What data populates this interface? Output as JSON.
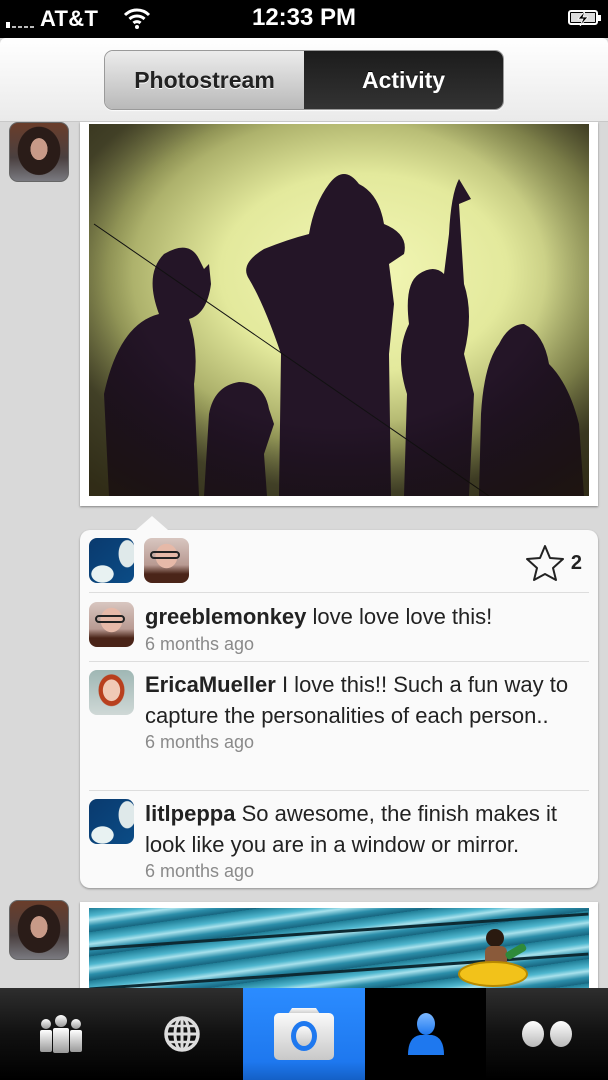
{
  "status_bar": {
    "carrier": "AT&T",
    "time": "12:33 PM",
    "signal_icon": "signal-bars-icon",
    "wifi_icon": "wifi-icon",
    "battery_icon": "battery-charging-icon"
  },
  "segmented_control": {
    "options": [
      {
        "label": "Photostream",
        "selected": false
      },
      {
        "label": "Activity",
        "selected": true
      }
    ]
  },
  "feed": {
    "items": [
      {
        "type": "photo",
        "owner_avatar": "user-avatar",
        "photo_description": "shadow silhouettes of five people on a yellow-green wall",
        "likes": {
          "star_icon": "star-icon",
          "count": "2",
          "likers": [
            "litlpeppa",
            "greeblemonkey"
          ]
        },
        "comments": [
          {
            "user": "greeblemonkey",
            "text": " love love love this!",
            "time": "6 months ago"
          },
          {
            "user": "EricaMueller",
            "text": " I love this!! Such a fun way to capture the personalities of each person..",
            "time": "6 months ago"
          },
          {
            "user": "litlpeppa",
            "text": " So awesome, the finish makes it look like you are in a window or mirror.",
            "time": "6 months ago"
          }
        ]
      },
      {
        "type": "photo",
        "owner_avatar": "user-avatar",
        "photo_description": "child in yellow float in swimming pool"
      }
    ]
  },
  "tab_bar": {
    "tabs": [
      {
        "name": "contacts",
        "icon": "people-icon",
        "selected": false
      },
      {
        "name": "explore",
        "icon": "globe-icon",
        "selected": false
      },
      {
        "name": "camera",
        "icon": "camera-icon",
        "selected": false,
        "highlight": "#2589ff"
      },
      {
        "name": "you",
        "icon": "person-icon",
        "selected": true
      },
      {
        "name": "flickr",
        "icon": "flickr-dots-icon",
        "selected": false
      }
    ]
  },
  "colors": {
    "accent_blue": "#2589ff",
    "background": "#d9d9d9",
    "timestamp_gray": "#8a8a8a"
  }
}
